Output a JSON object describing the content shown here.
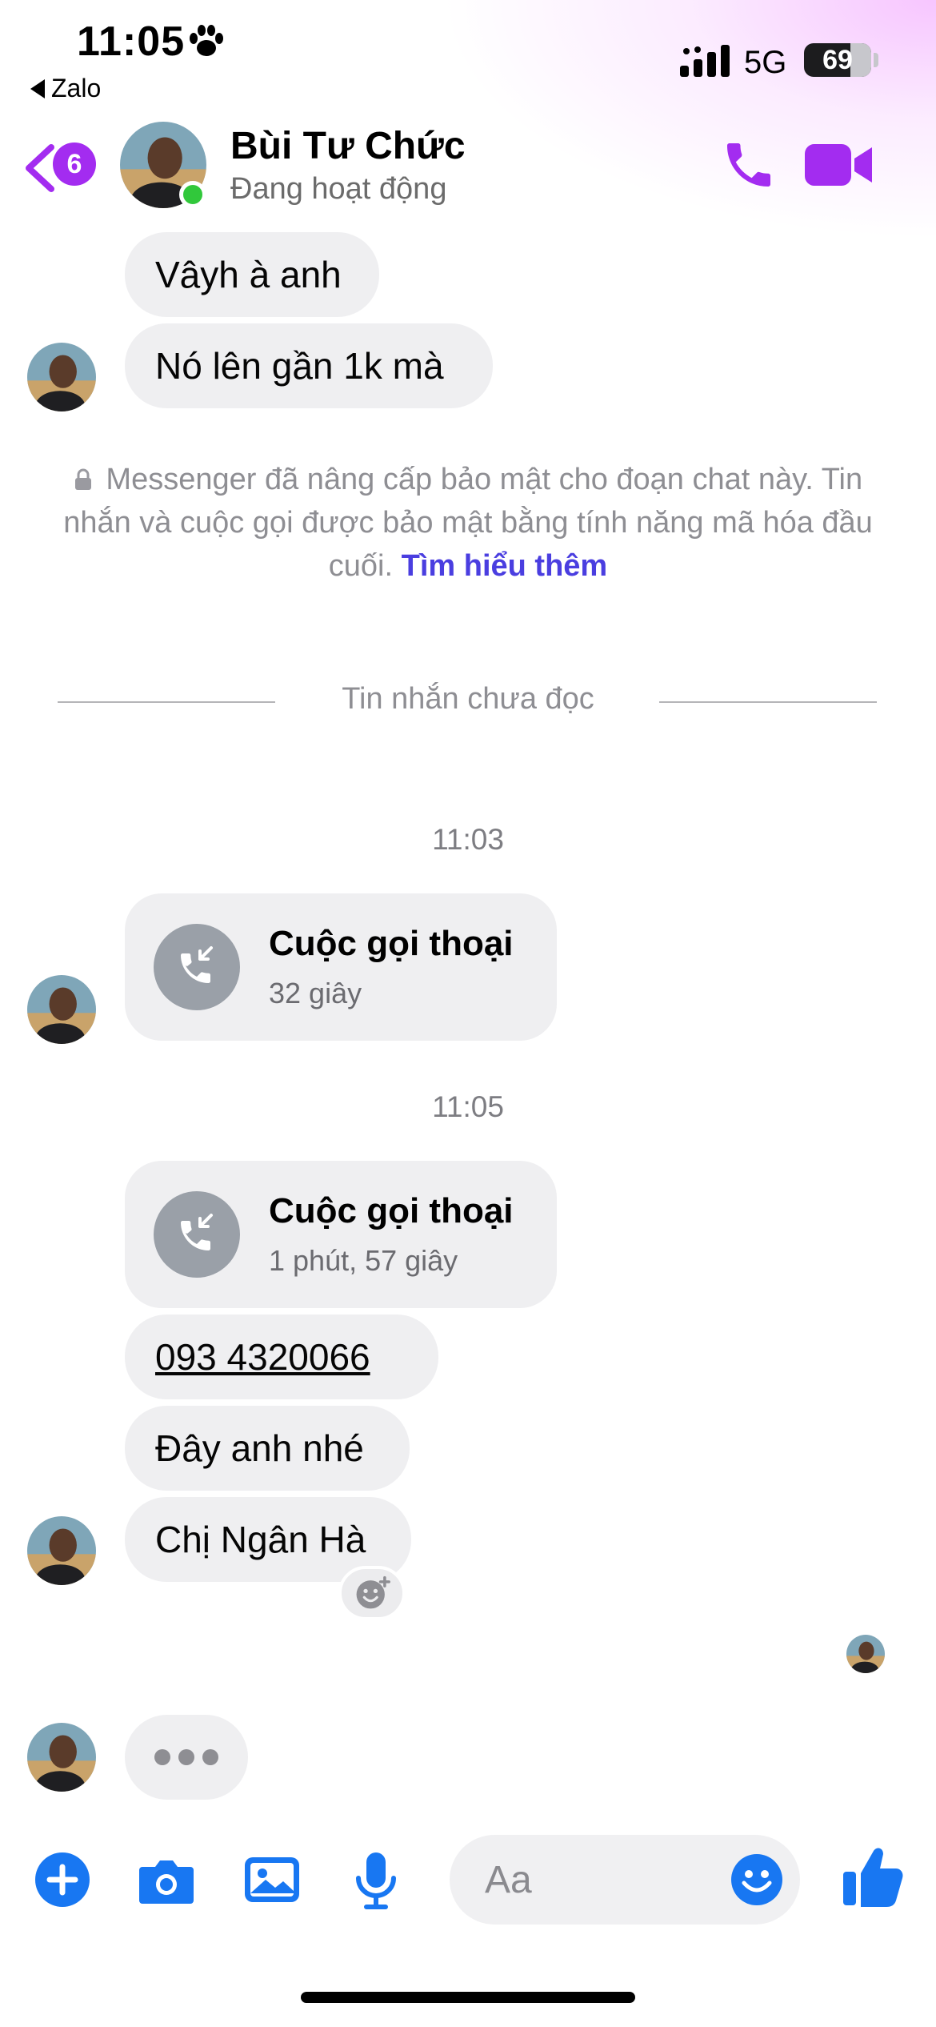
{
  "status_bar": {
    "time": "11:05",
    "back_app": "Zalo",
    "network": "5G",
    "battery": "69",
    "battery_level": 0.69
  },
  "header": {
    "unread_count": "6",
    "name": "Bùi Tư Chức",
    "status": "Đang hoạt động",
    "accent_color": "#a32cf0"
  },
  "messages": {
    "msg1": "Vâyh à anh",
    "msg2": "Nó lên gần 1k mà",
    "security_note": "Messenger đã nâng cấp bảo mật cho đoạn chat này. Tin nhắn và cuộc gọi được bảo mật bằng tính năng mã hóa đầu cuối.",
    "learn_more": "Tìm hiểu thêm",
    "unread_divider": "Tin nhắn chưa đọc",
    "time1": "11:03",
    "call1": {
      "title": "Cuộc gọi thoại",
      "duration": "32 giây"
    },
    "time2": "11:05",
    "call2": {
      "title": "Cuộc gọi thoại",
      "duration": "1 phút, 57 giây"
    },
    "phone": "093 4320066",
    "msg3": "Đây anh nhé",
    "msg4": "Chị Ngân Hà"
  },
  "composer": {
    "placeholder": "Aa",
    "icon_color": "#1877f2"
  }
}
